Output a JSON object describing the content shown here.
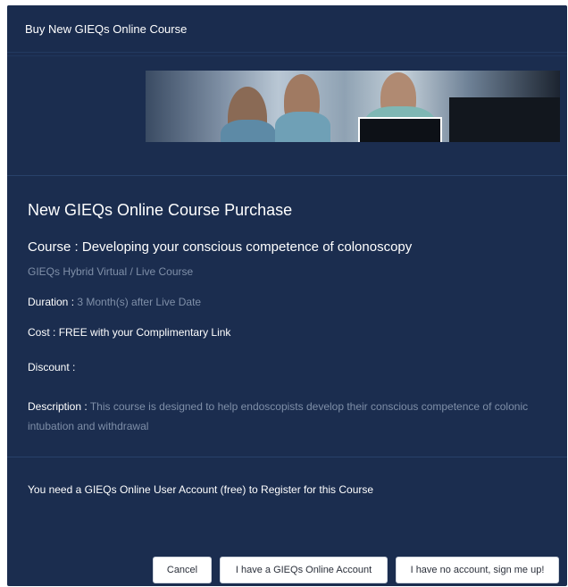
{
  "modal": {
    "title": "Buy New GIEQs Online Course"
  },
  "purchase": {
    "heading": "New GIEQs Online Course Purchase",
    "course_label": "Course :",
    "course_name": "Developing your conscious competence of colonoscopy",
    "course_type": "GIEQs Hybrid Virtual / Live Course",
    "duration_label": "Duration :",
    "duration_value": "3 Month(s) after Live Date",
    "cost_label": "Cost :",
    "cost_value": "FREE with your Complimentary Link",
    "discount_label": "Discount :",
    "discount_value": "",
    "description_label": "Description :",
    "description_value": "This course is designed to help endoscopists develop their conscious competence of colonic intubation and withdrawal"
  },
  "account_note": "You need a GIEQs Online User Account (free) to Register for this Course",
  "buttons": {
    "cancel": "Cancel",
    "have_account": "I have a GIEQs Online Account",
    "no_account": "I have no account, sign me up!"
  },
  "colors": {
    "modal_bg": "#1b2d4f",
    "muted_text": "#7f8fa8",
    "button_bg": "#ffffff"
  }
}
